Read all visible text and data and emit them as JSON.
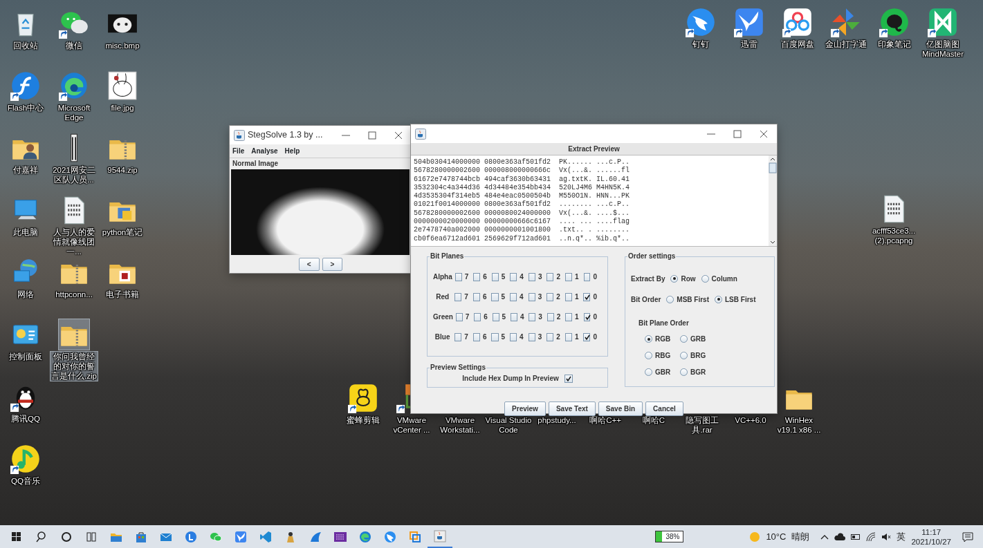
{
  "desktop": {
    "left_columns": [
      [
        {
          "label": "回收站",
          "kind": "recycle-bin",
          "shortcut": false,
          "selected": false
        },
        {
          "label": "Flash中心",
          "kind": "flash-app",
          "shortcut": true,
          "selected": false
        },
        {
          "label": "付嘉祥",
          "kind": "person-folder",
          "shortcut": false,
          "selected": false
        },
        {
          "label": "此电脑",
          "kind": "computer",
          "shortcut": false,
          "selected": false
        },
        {
          "label": "网络",
          "kind": "network",
          "shortcut": false,
          "selected": false
        },
        {
          "label": "控制面板",
          "kind": "control-panel",
          "shortcut": false,
          "selected": false
        },
        {
          "label": "腾讯QQ",
          "kind": "penguin",
          "shortcut": true,
          "selected": false
        },
        {
          "label": "QQ音乐",
          "kind": "music-app",
          "shortcut": true,
          "selected": false
        }
      ],
      [
        {
          "label": "微信",
          "kind": "chat-app",
          "shortcut": true,
          "selected": false
        },
        {
          "label": "Microsoft Edge",
          "kind": "browser",
          "shortcut": true,
          "selected": false
        },
        {
          "label": "2021网安二区队人员...",
          "kind": "document-strip",
          "shortcut": false,
          "selected": false
        },
        {
          "label": "人与人的爱情就像线团一...",
          "kind": "binary-file",
          "shortcut": false,
          "selected": false
        },
        {
          "label": "httpconn...",
          "kind": "zip-folder",
          "shortcut": false,
          "selected": false
        },
        {
          "label": "你问我曾经的对你的誓言是什么.zip",
          "kind": "zip-folder",
          "shortcut": false,
          "selected": true
        }
      ],
      [
        {
          "label": "misc.bmp",
          "kind": "bitmap-image",
          "shortcut": false,
          "selected": false
        },
        {
          "label": "file.jpg",
          "kind": "sketch-image",
          "shortcut": false,
          "selected": false
        },
        {
          "label": "9544.zip",
          "kind": "zip-folder",
          "shortcut": false,
          "selected": false
        },
        {
          "label": "python笔记",
          "kind": "doc-folder",
          "shortcut": false,
          "selected": false
        },
        {
          "label": "电子书籍",
          "kind": "book-folder",
          "shortcut": false,
          "selected": false
        }
      ]
    ],
    "top_right_icons": [
      {
        "label": "钉钉",
        "kind": "bird-circle",
        "shortcut": true,
        "selected": false
      },
      {
        "label": "迅雷",
        "kind": "bird-square",
        "shortcut": true,
        "selected": false
      },
      {
        "label": "百度网盘",
        "kind": "cloud-app",
        "shortcut": true,
        "selected": false
      },
      {
        "label": "金山打字通",
        "kind": "pinwheel",
        "shortcut": true,
        "selected": false
      },
      {
        "label": "印象笔记",
        "kind": "elephant-app",
        "shortcut": true,
        "selected": false
      },
      {
        "label": "亿图脑图MindMaster",
        "kind": "mindmap-app",
        "shortcut": true,
        "selected": false
      }
    ],
    "right_icons": [
      {
        "label": "acfff53ce3...(2).pcapng",
        "kind": "binary-file",
        "shortcut": false,
        "selected": false
      }
    ],
    "bottom_row_icons": [
      {
        "label": "蜜蜂剪辑",
        "kind": "bee-app",
        "shortcut": true,
        "selected": false
      },
      {
        "label": "VMware vCenter ...",
        "kind": "vm-app",
        "shortcut": true,
        "selected": false
      },
      {
        "label": "VMware Workstati...",
        "kind": "covered",
        "selected": false
      },
      {
        "label": "Visual Studio Code",
        "kind": "covered",
        "selected": false
      },
      {
        "label": "phpstudy...",
        "kind": "covered",
        "selected": false
      },
      {
        "label": "啊哈C++",
        "kind": "covered",
        "selected": false
      },
      {
        "label": "啊哈C",
        "kind": "covered",
        "selected": false
      },
      {
        "label": "隐写图工具.rar",
        "kind": "covered",
        "selected": false
      },
      {
        "label": "VC++6.0",
        "kind": "covered",
        "selected": false
      },
      {
        "label": "WinHex v19.1 x86 ...",
        "kind": "folder",
        "shortcut": false,
        "selected": false
      }
    ]
  },
  "stegsolve_window": {
    "title": "StegSolve 1.3 by ...",
    "menu": [
      "File",
      "Analyse",
      "Help"
    ],
    "image_label": "Normal Image",
    "nav_buttons": [
      "<",
      ">"
    ]
  },
  "extract_window": {
    "heading": "Extract Preview",
    "hex_lines": [
      "504b030414000000 0800e363af501fd2  PK...... ...c.P..",
      "5678280000002600 000008000000666c  Vx(...&. ......fl",
      "61672e7478744bcb 494caf3630b63431  ag.txtK. IL.60.41",
      "3532304c4a344d36 4d34484e354bb434  520LJ4M6 M4HN5K.4",
      "4d3535304f314eb5 484e4eac0500504b  M550O1N. HNN...PK",
      "01021f0014000000 0800e363af501fd2  ........ ...c.P..",
      "5678280000002600 0000080024000000  Vx(...&. ....$...",
      "0000000020000000 00000000666c6167  .... ... ....flag",
      "2e7478740a002000 0000000001001800  .txt.. . ........",
      "cb0f6ea6712ad601 2569629f712ad601  ..n.q*.. %ib.q*.."
    ],
    "bit_planes": {
      "title": "Bit Planes",
      "channels": [
        {
          "label": "Alpha",
          "bits": [
            {
              "label": "7",
              "checked": false
            },
            {
              "label": "6",
              "checked": false
            },
            {
              "label": "5",
              "checked": false
            },
            {
              "label": "4",
              "checked": false
            },
            {
              "label": "3",
              "checked": false
            },
            {
              "label": "2",
              "checked": false
            },
            {
              "label": "1",
              "checked": false
            },
            {
              "label": "0",
              "checked": false
            }
          ]
        },
        {
          "label": "Red",
          "bits": [
            {
              "label": "7",
              "checked": false
            },
            {
              "label": "6",
              "checked": false
            },
            {
              "label": "5",
              "checked": false
            },
            {
              "label": "4",
              "checked": false
            },
            {
              "label": "3",
              "checked": false
            },
            {
              "label": "2",
              "checked": false
            },
            {
              "label": "1",
              "checked": false
            },
            {
              "label": "0",
              "checked": true
            }
          ]
        },
        {
          "label": "Green",
          "bits": [
            {
              "label": "7",
              "checked": false
            },
            {
              "label": "6",
              "checked": false
            },
            {
              "label": "5",
              "checked": false
            },
            {
              "label": "4",
              "checked": false
            },
            {
              "label": "3",
              "checked": false
            },
            {
              "label": "2",
              "checked": false
            },
            {
              "label": "1",
              "checked": false
            },
            {
              "label": "0",
              "checked": true
            }
          ]
        },
        {
          "label": "Blue",
          "bits": [
            {
              "label": "7",
              "checked": false
            },
            {
              "label": "6",
              "checked": false
            },
            {
              "label": "5",
              "checked": false
            },
            {
              "label": "4",
              "checked": false
            },
            {
              "label": "3",
              "checked": false
            },
            {
              "label": "2",
              "checked": false
            },
            {
              "label": "1",
              "checked": false
            },
            {
              "label": "0",
              "checked": true
            }
          ]
        }
      ]
    },
    "preview_settings": {
      "title": "Preview Settings",
      "label": "Include Hex Dump In Preview",
      "checked": true
    },
    "order_settings": {
      "title": "Order settings",
      "extract_by": {
        "label": "Extract By",
        "options": [
          {
            "label": "Row",
            "selected": true
          },
          {
            "label": "Column",
            "selected": false
          }
        ]
      },
      "bit_order": {
        "label": "Bit Order",
        "options": [
          {
            "label": "MSB First",
            "selected": false
          },
          {
            "label": "LSB First",
            "selected": true
          }
        ]
      },
      "bit_plane_order": {
        "label": "Bit Plane Order",
        "options": [
          {
            "label": "RGB",
            "selected": true
          },
          {
            "label": "GRB",
            "selected": false
          },
          {
            "label": "RBG",
            "selected": false
          },
          {
            "label": "BRG",
            "selected": false
          },
          {
            "label": "GBR",
            "selected": false
          },
          {
            "label": "BGR",
            "selected": false
          }
        ]
      }
    },
    "buttons": [
      "Preview",
      "Save Text",
      "Save Bin",
      "Cancel"
    ]
  },
  "taskbar": {
    "battery": "38%",
    "temperature": "10°C",
    "weather": "晴朗",
    "input_method": "英",
    "time": "11:17",
    "date": "2021/10/27"
  }
}
